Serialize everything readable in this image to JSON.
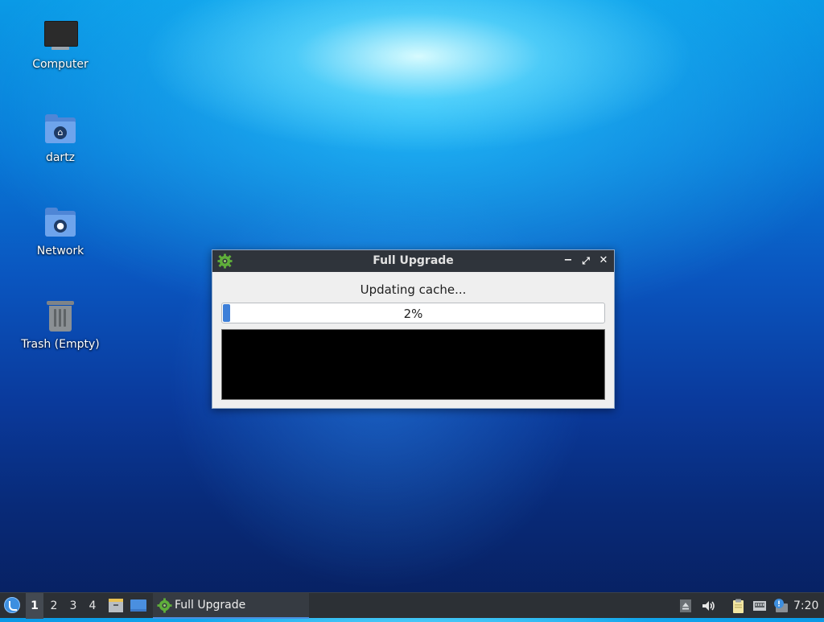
{
  "desktop": {
    "icons": [
      {
        "label": "Computer",
        "icon": "computer-icon"
      },
      {
        "label": "dartz",
        "icon": "home-folder-icon"
      },
      {
        "label": "Network",
        "icon": "network-folder-icon"
      },
      {
        "label": "Trash (Empty)",
        "icon": "trash-icon"
      }
    ]
  },
  "dialog": {
    "title": "Full Upgrade",
    "icon": "gear-icon",
    "status": "Updating cache...",
    "progress_text": "2%",
    "progress_fraction": 0.02,
    "controls": [
      "minimize-icon",
      "maximize-icon",
      "close-icon"
    ]
  },
  "taskbar": {
    "start_icon": "lxqt-start-icon",
    "workspaces": [
      "1",
      "2",
      "3",
      "4"
    ],
    "active_workspace": "1",
    "launchers": [
      "file-manager-icon",
      "show-desktop-icon"
    ],
    "task_label": "Full Upgrade",
    "tray": [
      "eject-icon",
      "volume-icon",
      "clipboard-icon",
      "network-icon",
      "update-notifier-icon"
    ],
    "clock": "7:20"
  },
  "colors": {
    "titlebar": "#2f343b",
    "taskbar": "#2c3035",
    "progress_fill": "#3d7fd8",
    "accent": "#4a8fe0"
  }
}
